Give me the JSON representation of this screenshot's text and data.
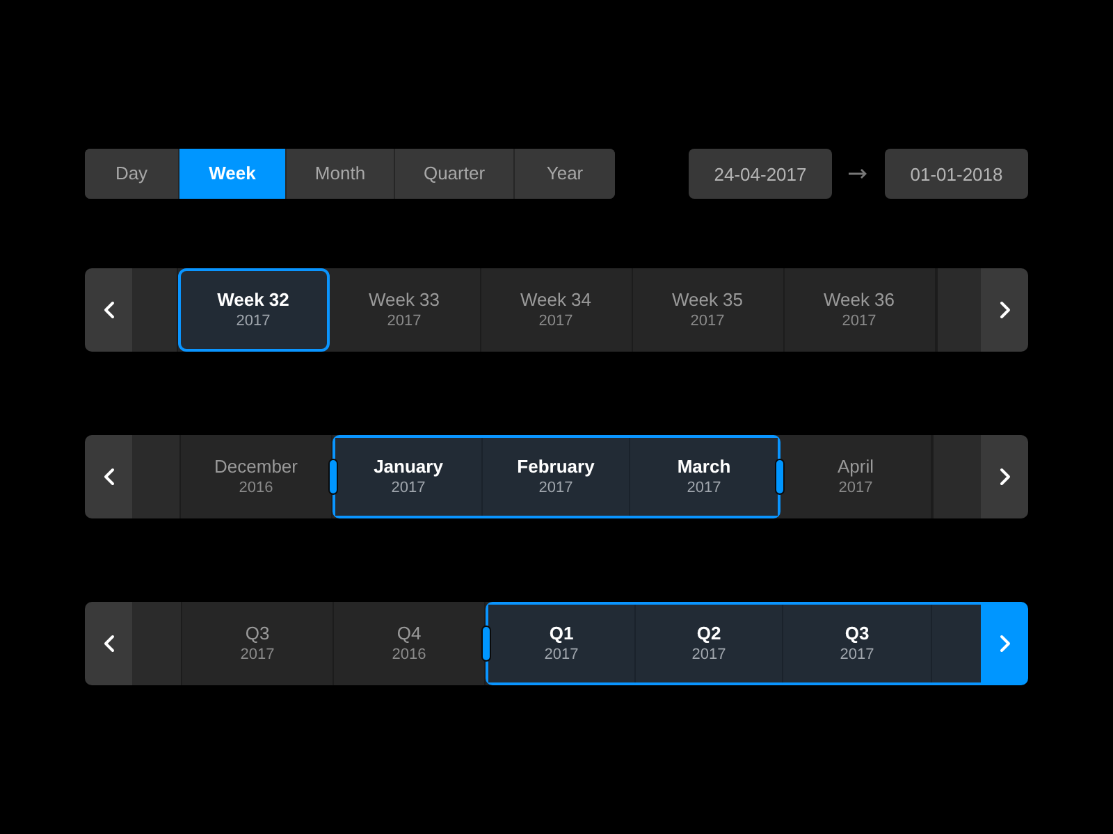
{
  "view_tabs": [
    {
      "label": "Day",
      "selected": false
    },
    {
      "label": "Week",
      "selected": true
    },
    {
      "label": "Month",
      "selected": false
    },
    {
      "label": "Quarter",
      "selected": false
    },
    {
      "label": "Year",
      "selected": false
    }
  ],
  "date_range": {
    "start": "24-04-2017",
    "end": "01-01-2018"
  },
  "timelines": [
    {
      "kind": "single",
      "prev_button": {
        "highlighted": false
      },
      "next_button": {
        "highlighted": false
      },
      "items": [
        {
          "label": "Week 32",
          "year": "2017",
          "selected": true
        },
        {
          "label": "Week 33",
          "year": "2017",
          "selected": false
        },
        {
          "label": "Week 34",
          "year": "2017",
          "selected": false
        },
        {
          "label": "Week 35",
          "year": "2017",
          "selected": false
        },
        {
          "label": "Week 36",
          "year": "2017",
          "selected": false
        }
      ]
    },
    {
      "kind": "range",
      "range_open_end": false,
      "prev_button": {
        "highlighted": false
      },
      "next_button": {
        "highlighted": false
      },
      "items": [
        {
          "label": "December",
          "year": "2016",
          "selected": false
        },
        {
          "label": "January",
          "year": "2017",
          "selected": true
        },
        {
          "label": "February",
          "year": "2017",
          "selected": true
        },
        {
          "label": "March",
          "year": "2017",
          "selected": true
        },
        {
          "label": "April",
          "year": "2017",
          "selected": false
        }
      ]
    },
    {
      "kind": "range",
      "range_open_end": true,
      "prev_button": {
        "highlighted": false
      },
      "next_button": {
        "highlighted": true
      },
      "items": [
        {
          "label": "Q3",
          "year": "2017",
          "selected": false
        },
        {
          "label": "Q4",
          "year": "2016",
          "selected": false
        },
        {
          "label": "Q1",
          "year": "2017",
          "selected": true
        },
        {
          "label": "Q2",
          "year": "2017",
          "selected": true
        },
        {
          "label": "Q3",
          "year": "2017",
          "selected": true
        }
      ]
    }
  ]
}
